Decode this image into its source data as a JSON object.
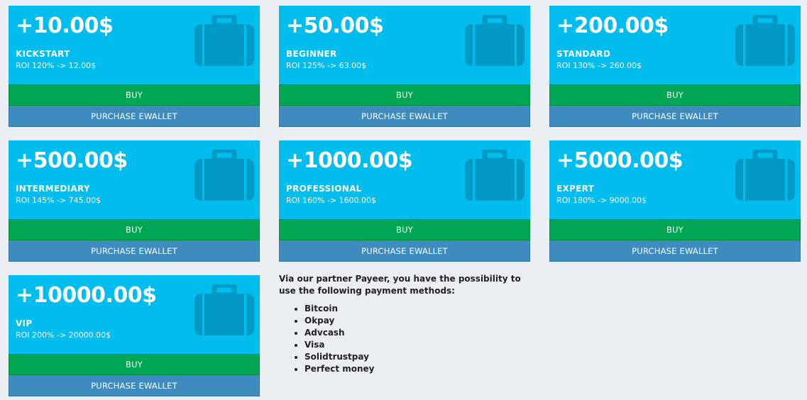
{
  "plans": [
    {
      "amount": "+10.00$",
      "name": "KICKSTART",
      "roi": "ROI 120% -> 12.00$",
      "buy_label": "BUY",
      "ewallet_label": "PURCHASE EWALLET"
    },
    {
      "amount": "+50.00$",
      "name": "BEGINNER",
      "roi": "ROI 125% -> 63.00$",
      "buy_label": "BUY",
      "ewallet_label": "PURCHASE EWALLET"
    },
    {
      "amount": "+200.00$",
      "name": "STANDARD",
      "roi": "ROI 130% -> 260.00$",
      "buy_label": "BUY",
      "ewallet_label": "PURCHASE EWALLET"
    },
    {
      "amount": "+500.00$",
      "name": "INTERMEDIARY",
      "roi": "ROI 145% -> 745.00$",
      "buy_label": "BUY",
      "ewallet_label": "PURCHASE EWALLET"
    },
    {
      "amount": "+1000.00$",
      "name": "PROFESSIONAL",
      "roi": "ROI 160% -> 1600.00$",
      "buy_label": "BUY",
      "ewallet_label": "PURCHASE EWALLET"
    },
    {
      "amount": "+5000.00$",
      "name": "EXPERT",
      "roi": "ROI 180% -> 9000.00$",
      "buy_label": "BUY",
      "ewallet_label": "PURCHASE EWALLET"
    },
    {
      "amount": "+10000.00$",
      "name": "VIP",
      "roi": "ROI 200% -> 20000.00$",
      "buy_label": "BUY",
      "ewallet_label": "PURCHASE EWALLET"
    }
  ],
  "card_icon": "briefcase-icon",
  "colors": {
    "card_bg": "#00bdee",
    "buy_button": "#00a653",
    "ewallet_button": "#3e8bbf",
    "page_bg": "#ebeef2"
  },
  "payment_info": {
    "intro": "Via our partner Payeer, you have the possibility to use the following payment methods:",
    "methods": [
      "Bitcoin",
      "Okpay",
      "Advcash",
      "Visa",
      "Solidtrustpay",
      "Perfect money"
    ]
  }
}
